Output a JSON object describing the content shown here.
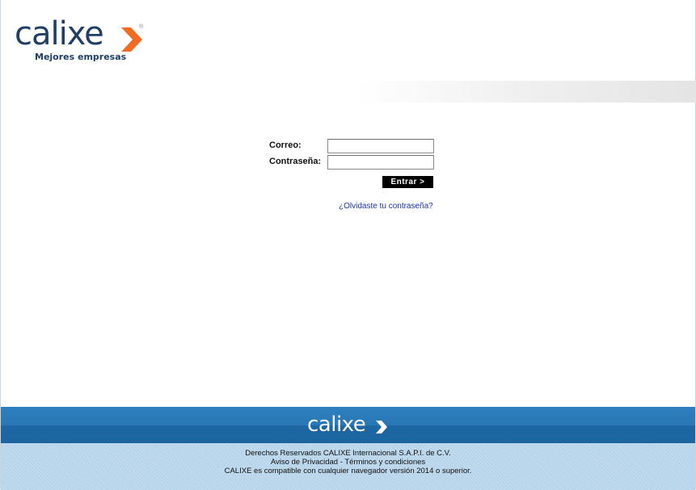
{
  "header": {
    "logo_word": "calixe",
    "logo_tagline": "Mejores empresas",
    "logo_reg": "®"
  },
  "login": {
    "email_label": "Correo:",
    "email_value": "",
    "password_label": "Contraseña:",
    "password_value": "",
    "submit_label": "Entrar >",
    "forgot_link": "¿Olvidaste tu contraseña?"
  },
  "footer": {
    "logo_word": "calixe",
    "lines": [
      "Derechos Reservados CALIXE Internacional S.A.P.I. de C.V.",
      "Aviso de Privacidad - Términos y condiciones",
      "CALIXE es compatible con cualquier navegador versión 2014 o superior."
    ]
  },
  "colors": {
    "brand_navy": "#1f3f66",
    "brand_orange": "#f26b22",
    "footer_blue": "#2a78b6",
    "footer_light": "#b7d4ea",
    "link_blue": "#1a34a8"
  }
}
